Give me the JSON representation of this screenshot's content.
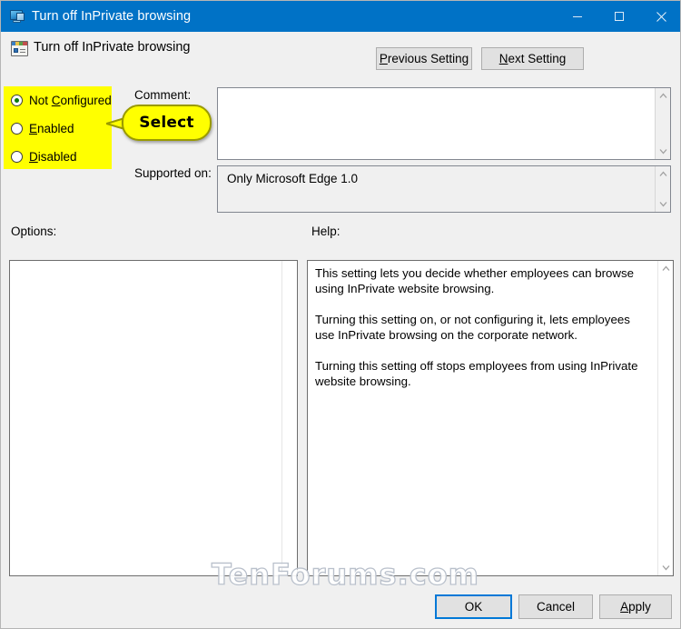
{
  "window": {
    "title": "Turn off InPrivate browsing",
    "icon": "policy-setting-icon",
    "controls": {
      "minimize": "minimize-icon",
      "maximize": "maximize-icon",
      "close": "close-icon"
    }
  },
  "header": {
    "title": "Turn off InPrivate browsing",
    "icon": "group-policy-icon",
    "previous_setting": {
      "pre": "P",
      "rest": "revious Setting"
    },
    "next_setting": {
      "pre": "N",
      "rest": "ext Setting"
    }
  },
  "state": {
    "options": [
      {
        "label_pre": "Not ",
        "label_acc": "C",
        "label_post": "onfigured",
        "selected": true
      },
      {
        "label_pre": "",
        "label_acc": "E",
        "label_post": "nabled",
        "selected": false
      },
      {
        "label_pre": "",
        "label_acc": "D",
        "label_post": "isabled",
        "selected": false
      }
    ],
    "highlight_color": "#ffff00"
  },
  "callout": {
    "text": "Select",
    "background": "#ffff00"
  },
  "comment": {
    "label": "Comment:",
    "value": "",
    "placeholder": ""
  },
  "supported_on": {
    "label": "Supported on:",
    "value": "Only Microsoft Edge 1.0"
  },
  "panels": {
    "options_label": "Options:",
    "help_label": "Help:",
    "options_content": "",
    "help_paragraphs": [
      "This setting lets you decide whether employees can browse using InPrivate website browsing.",
      "Turning this setting on, or not configuring it, lets employees use InPrivate browsing on the corporate network.",
      "Turning this setting off stops employees from using InPrivate website browsing."
    ]
  },
  "watermark": {
    "text": "TenForums.com"
  },
  "footer": {
    "ok": "OK",
    "cancel": "Cancel",
    "apply": {
      "pre": "A",
      "rest": "pply"
    }
  },
  "colors": {
    "titlebar": "#0072c6",
    "dialog_face": "#f0f0f0",
    "highlight": "#ffff00",
    "focus_border": "#0078d7",
    "radio_dot": "#0a7a0a"
  }
}
